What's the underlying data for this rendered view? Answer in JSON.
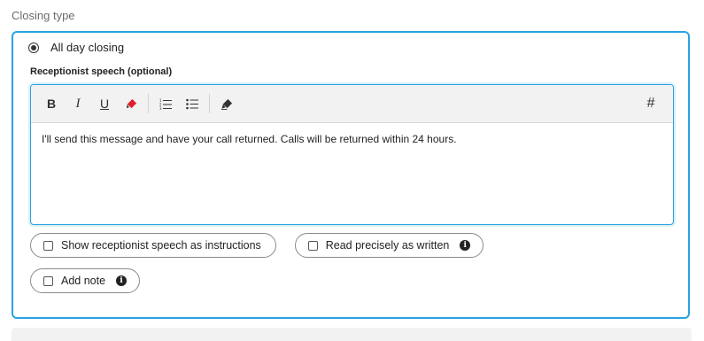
{
  "section": {
    "label": "Closing type"
  },
  "closing_option": {
    "label": "All day closing",
    "selected": true
  },
  "speech": {
    "label": "Receptionist speech (optional)",
    "text": "I'll send this message and have your call returned. Calls will be returned within 24 hours."
  },
  "toolbar": {
    "bold": "B",
    "italic": "I",
    "underline": "U",
    "hash": "#",
    "icons": [
      "bold-icon",
      "italic-icon",
      "underline-icon",
      "highlight-marker-icon",
      "ordered-list-icon",
      "bullet-list-icon",
      "eraser-icon",
      "hash-icon"
    ],
    "highlight_color": "#e0202a"
  },
  "options": {
    "show_instructions": "Show receptionist speech as instructions",
    "read_precisely": "Read precisely as written",
    "add_note": "Add note",
    "info_glyph": "i"
  },
  "colors": {
    "accent": "#2aa3e0",
    "toolbar_bg": "#f2f2f2"
  }
}
